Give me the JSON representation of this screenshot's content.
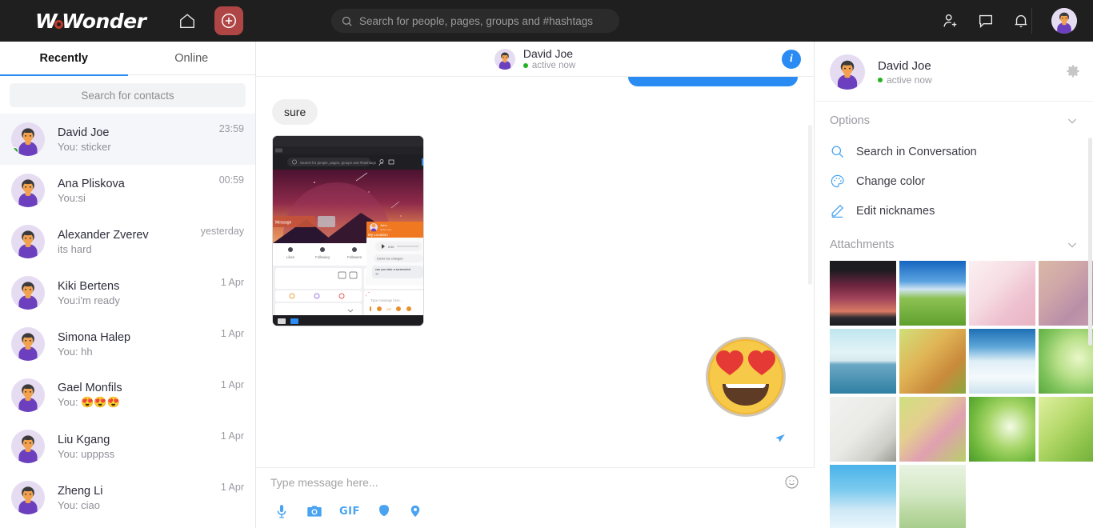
{
  "app": {
    "brand_name": "WoWonder",
    "brand_part1": "W",
    "brand_part2": "Wonder",
    "accent_blue": "#2a8bf2",
    "nav_bg": "#1f1f1f",
    "add_button_bg": "#b04545"
  },
  "topnav": {
    "home_icon": "home-icon",
    "add_icon": "plus-circle-icon",
    "search_placeholder": "Search for people, pages, groups and #hashtags",
    "search_value": "",
    "icons": [
      {
        "name": "add-friend-icon",
        "label": "Add friend"
      },
      {
        "name": "messages-icon",
        "label": "Messages"
      },
      {
        "name": "notifications-icon",
        "label": "Notifications"
      }
    ],
    "avatar": "user-avatar"
  },
  "sidebar": {
    "tabs": [
      {
        "label": "Recently",
        "active": true
      },
      {
        "label": "Online",
        "active": false
      }
    ],
    "search_placeholder": "Search for contacts",
    "search_value": "",
    "contacts": [
      {
        "name": "David Joe",
        "preview": "You: sticker",
        "time": "23:59",
        "online": true,
        "active": true
      },
      {
        "name": "Ana Pliskova",
        "preview": "You:si",
        "time": "00:59",
        "online": false,
        "active": false
      },
      {
        "name": "Alexander Zverev",
        "preview": "its hard",
        "time": "yesterday",
        "online": false,
        "active": false
      },
      {
        "name": "Kiki Bertens",
        "preview": "You:i'm ready",
        "time": "1 Apr",
        "online": false,
        "active": false
      },
      {
        "name": "Simona Halep",
        "preview": "You: hh",
        "time": "1 Apr",
        "online": false,
        "active": false
      },
      {
        "name": "Gael Monfils",
        "preview": "You: 😍😍😍",
        "time": "1 Apr",
        "online": false,
        "active": false
      },
      {
        "name": "Liu Kgang",
        "preview": "You: upppss",
        "time": "1 Apr",
        "online": false,
        "active": false
      },
      {
        "name": "Zheng Li",
        "preview": "You: ciao",
        "time": "1 Apr",
        "online": false,
        "active": false
      }
    ]
  },
  "chat": {
    "header": {
      "name": "David Joe",
      "status": "active now",
      "info_icon": "info-icon",
      "info_letter": "i"
    },
    "messages": [
      {
        "type": "bubble-out-clipped",
        "text": "",
        "color": "#2a8bf2"
      },
      {
        "type": "bubble-in",
        "text": "sure"
      },
      {
        "type": "image",
        "alt": "screenshot-attachment"
      },
      {
        "type": "sticker",
        "alt": "heart-eyes-emoji",
        "emoji": "😍"
      }
    ],
    "seen_indicator": "sent-tick-icon",
    "composer": {
      "placeholder": "Type message here...",
      "value": "",
      "emoji_icon": "smiley-icon",
      "tools": [
        {
          "name": "microphone-icon",
          "label": "Record voice"
        },
        {
          "name": "camera-icon",
          "label": "Camera"
        },
        {
          "name": "gif-icon",
          "label": "GIF"
        },
        {
          "name": "sticker-icon",
          "label": "Sticker"
        },
        {
          "name": "location-icon",
          "label": "Location"
        }
      ]
    }
  },
  "rightpanel": {
    "profile": {
      "name": "David Joe",
      "status": "active now",
      "settings_icon": "gear-icon"
    },
    "sections": [
      {
        "title": "Options",
        "chevron": "chevron-down-icon",
        "expanded": true
      },
      {
        "title": "Attachments",
        "chevron": "chevron-down-icon",
        "expanded": true
      }
    ],
    "options": [
      {
        "label": "Search in Conversation",
        "icon": "search-icon"
      },
      {
        "label": "Change color",
        "icon": "palette-icon"
      },
      {
        "label": "Edit nicknames",
        "icon": "pencil-icon"
      }
    ],
    "attachments": [
      {
        "alt": "screenshot-thumbnail",
        "css": "linear-gradient(180deg,#1b1b20 0%,#1b1b20 14%,#6d2540 38%,#a0435a 58%,#d87a62 78%,#2a2a30 88%,#1b1b20 100%)"
      },
      {
        "alt": "green-field-sky",
        "css": "linear-gradient(180deg,#1565c0 0%,#5ba3e0 32%,#cfe4f2 44%,#8dc153 58%,#5fa02e 100%)"
      },
      {
        "alt": "cherry-blossom-pink",
        "css": "linear-gradient(135deg,#fbf0f2 0%,#f6dde4 40%,#eec0cf 70%,#e8b4c4 100%)"
      },
      {
        "alt": "purple-flower-bokeh",
        "css": "linear-gradient(135deg,#d9b8a6 0%,#cfa6a8 35%,#b98fa8 65%,#c9a0ae 100%)"
      },
      {
        "alt": "calm-sea-horizon",
        "css": "linear-gradient(180deg,#bfe6ee 0%,#e2f3f7 36%,#d6e9ee 49%,#6ba8c4 55%,#2f7fa3 100%)"
      },
      {
        "alt": "autumn-grass-leaves",
        "css": "linear-gradient(135deg,#cfe07a 0%,#e0b455 40%,#c98a3c 70%,#8aa83e 100%)"
      },
      {
        "alt": "snowy-winter-trees",
        "css": "linear-gradient(180deg,#1d6fb5 0%,#5fa7d8 28%,#dfeef6 50%,#f4fafc 75%,#cde2ee 100%)"
      },
      {
        "alt": "green-succulent-rose",
        "css": "radial-gradient(circle at 60% 45%,#e9f7c8 0%,#b9e08a 38%,#7dc25a 70%,#5aa83f 100%)"
      },
      {
        "alt": "kitten-on-blanket",
        "css": "linear-gradient(135deg,#f2f2f0 0%,#e9e9e6 50%,#cfcfc9 78%,#9a9a93 100%)"
      },
      {
        "alt": "pink-magnolia-branch",
        "css": "linear-gradient(135deg,#cfe07e 0%,#e4cf8f 35%,#e0a0b0 62%,#b8cf6a 100%)"
      },
      {
        "alt": "white-flower-on-green",
        "css": "radial-gradient(circle at 62% 46%,#f4fbe6 0%,#a8d66a 40%,#6fb83c 72%,#4c9a2c 100%)"
      },
      {
        "alt": "green-grass-blades",
        "css": "linear-gradient(135deg,#dff0a0 0%,#b5d96a 40%,#8cc24a 70%,#6aa836 100%)"
      },
      {
        "alt": "blue-sky-clouds",
        "css": "linear-gradient(180deg,#49b3e8 0%,#7ecbef 40%,#cfe9f6 70%,#eaf6fc 100%)"
      },
      {
        "alt": "soft-green-reeds",
        "css": "linear-gradient(180deg,#e9f3e2 0%,#d3e8c4 45%,#b9d8a0 75%,#a6cc8c 100%)"
      }
    ]
  }
}
